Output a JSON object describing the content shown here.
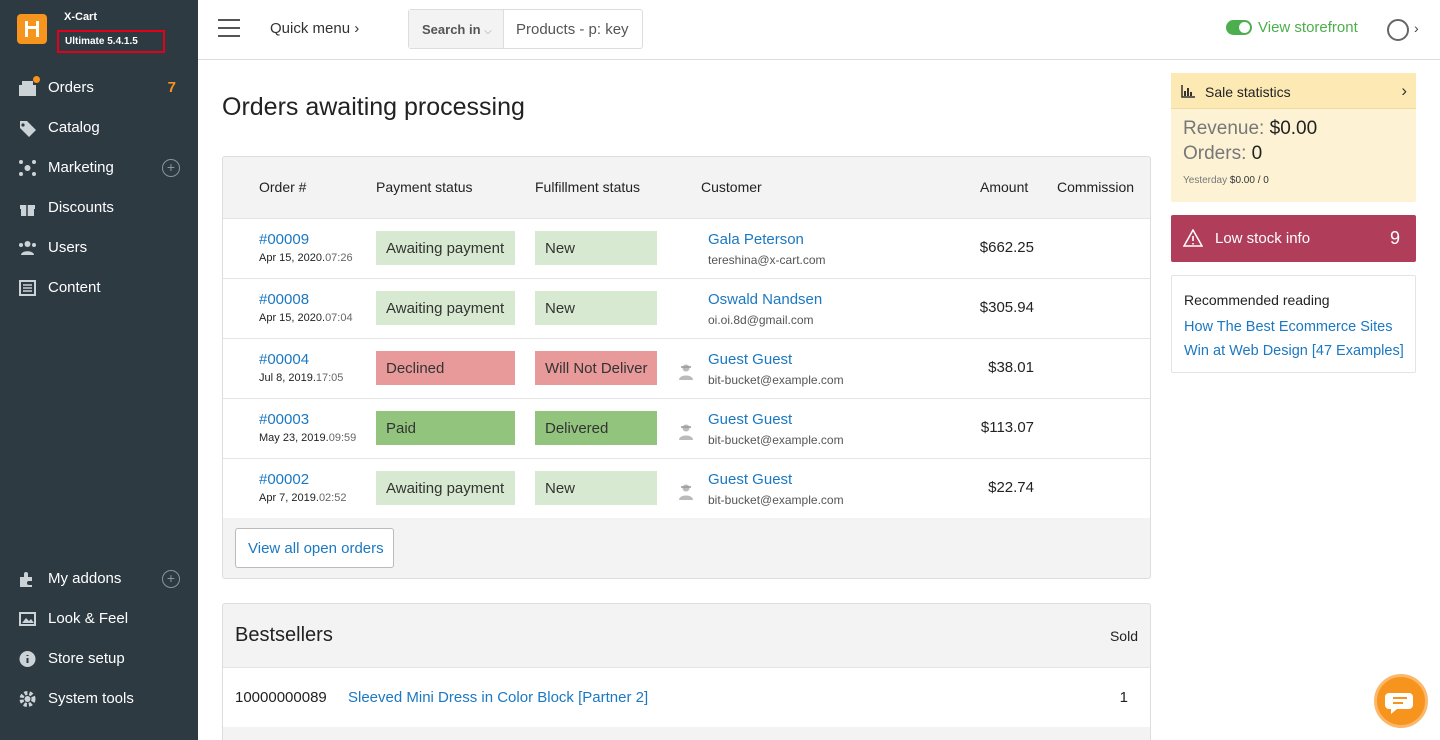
{
  "app": {
    "brand": "X-Cart",
    "version": "Ultimate 5.4.1.5"
  },
  "sidebar": {
    "items": [
      {
        "label": "Orders",
        "count": "7"
      },
      {
        "label": "Catalog"
      },
      {
        "label": "Marketing"
      },
      {
        "label": "Discounts"
      },
      {
        "label": "Users"
      },
      {
        "label": "Content"
      }
    ],
    "bottom": [
      {
        "label": "My addons"
      },
      {
        "label": "Look & Feel"
      },
      {
        "label": "Store setup"
      },
      {
        "label": "System tools"
      }
    ]
  },
  "topbar": {
    "quick_menu": "Quick menu",
    "search_scope": "Search in",
    "search_placeholder": "Products - p: key",
    "view_storefront": "View storefront"
  },
  "orders": {
    "title": "Orders awaiting processing",
    "columns": [
      "Order #",
      "Payment status",
      "Fulfillment status",
      "Customer",
      "Amount",
      "Commission"
    ],
    "rows": [
      {
        "number": "#00009",
        "date": "Apr 15, 2020.",
        "time": "07:26",
        "payment": "Awaiting payment",
        "fulfillment": "New",
        "customer": "Gala Peterson",
        "email": "tereshina@x-cart.com",
        "amount": "$662.25"
      },
      {
        "number": "#00008",
        "date": "Apr 15, 2020.",
        "time": "07:04",
        "payment": "Awaiting payment",
        "fulfillment": "New",
        "customer": "Oswald Nandsen",
        "email": "oi.oi.8d@gmail.com",
        "amount": "$305.94"
      },
      {
        "number": "#00004",
        "date": "Jul 8, 2019.",
        "time": "17:05",
        "payment": "Declined",
        "fulfillment": "Will Not Deliver",
        "customer": "Guest Guest",
        "email": "bit-bucket@example.com",
        "amount": "$38.01"
      },
      {
        "number": "#00003",
        "date": "May 23, 2019.",
        "time": "09:59",
        "payment": "Paid",
        "fulfillment": "Delivered",
        "customer": "Guest Guest",
        "email": "bit-bucket@example.com",
        "amount": "$113.07"
      },
      {
        "number": "#00002",
        "date": "Apr 7, 2019.",
        "time": "02:52",
        "payment": "Awaiting payment",
        "fulfillment": "New",
        "customer": "Guest Guest",
        "email": "bit-bucket@example.com",
        "amount": "$22.74"
      }
    ],
    "view_all": "View all open orders"
  },
  "bestsellers": {
    "title": "Bestsellers",
    "sold_header": "Sold",
    "rows": [
      {
        "sku": "10000000089",
        "name": "Sleeved Mini Dress in Color Block [Partner 2]",
        "sold": "1"
      }
    ]
  },
  "sale_stats": {
    "title": "Sale statistics",
    "revenue_label": "Revenue:",
    "revenue_value": "$0.00",
    "orders_label": "Orders:",
    "orders_value": "0",
    "yesterday_label": "Yesterday",
    "yesterday_value": "$0.00 / 0"
  },
  "low_stock": {
    "label": "Low stock info",
    "count": "9"
  },
  "reading": {
    "title": "Recommended reading",
    "link": "How The Best Ecommerce Sites Win at Web Design [47 Examples]"
  },
  "colors": {
    "sidebar": "#2d3a42",
    "accent": "#f7941d",
    "link": "#1b78c2",
    "low_stock": "#b03d5a",
    "storefront": "#4cae4c"
  }
}
